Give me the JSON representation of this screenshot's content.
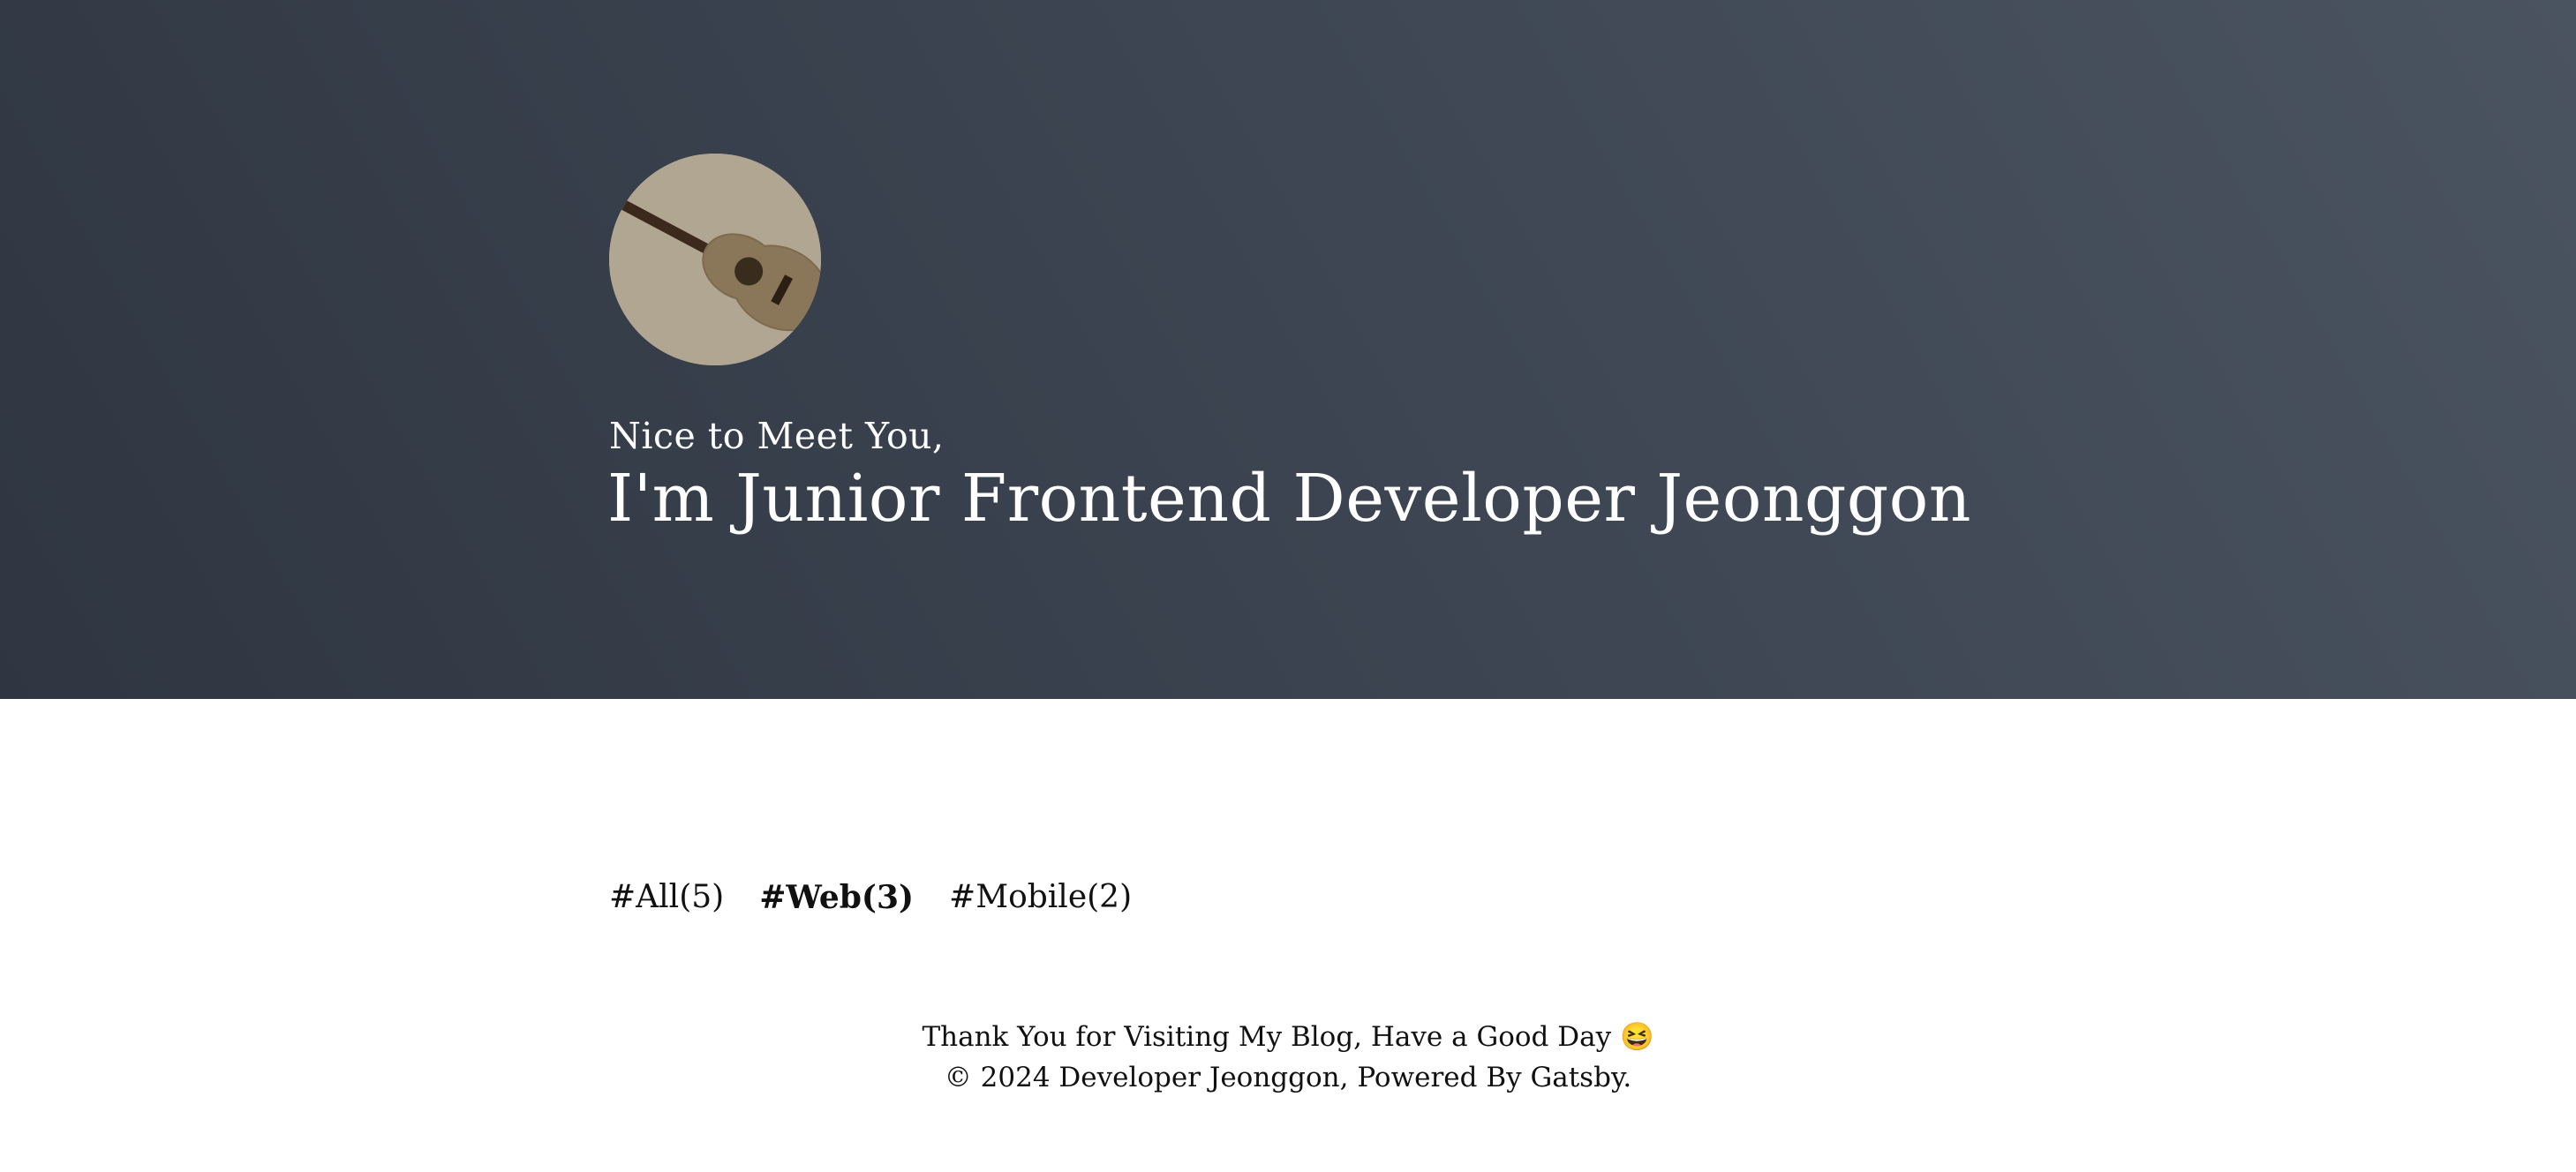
{
  "hero": {
    "avatar_alt": "acoustic guitar",
    "greeting": "Nice to Meet You,",
    "headline": "I'm Junior Frontend Developer Jeonggon"
  },
  "categories": [
    {
      "label": "#All(5)",
      "active": false
    },
    {
      "label": "#Web(3)",
      "active": true
    },
    {
      "label": "#Mobile(2)",
      "active": false
    }
  ],
  "footer": {
    "line1": "Thank You for Visiting My Blog, Have a Good Day 😆",
    "line2": "© 2024 Developer Jeonggon, Powered By Gatsby."
  },
  "colors": {
    "hero_dark": "#2f3641",
    "hero_light": "#4a5360",
    "avatar_bg": "#b1a692",
    "text_dark": "#111111"
  },
  "icons": {
    "avatar": "guitar-icon"
  }
}
